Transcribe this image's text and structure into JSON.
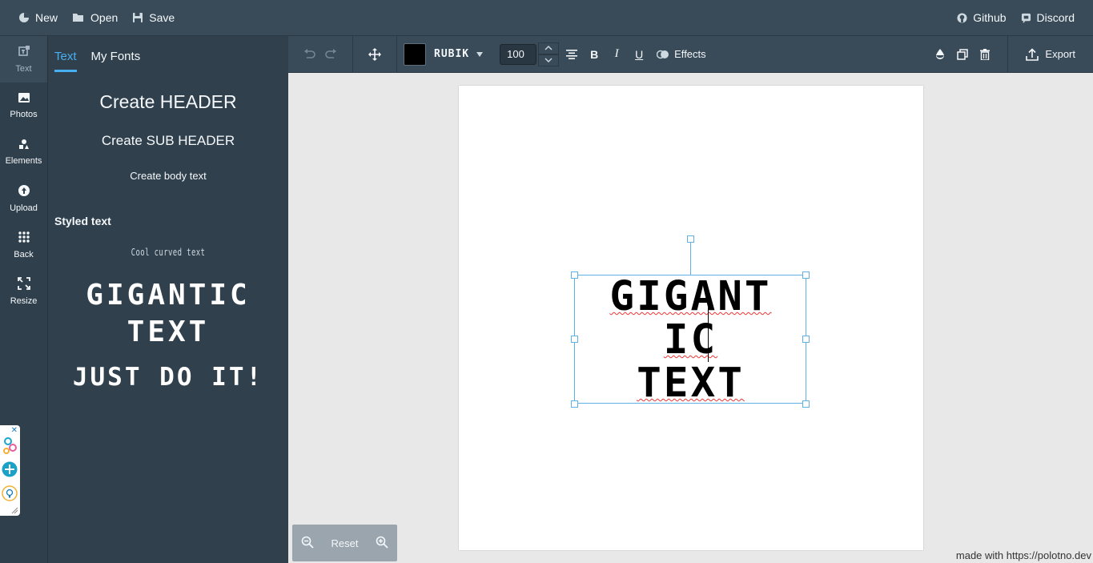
{
  "topbar": {
    "new_label": "New",
    "open_label": "Open",
    "save_label": "Save",
    "github_label": "Github",
    "discord_label": "Discord"
  },
  "iconbar": {
    "items": [
      {
        "label": "Text",
        "icon": "text-icon"
      },
      {
        "label": "Photos",
        "icon": "photos-icon"
      },
      {
        "label": "Elements",
        "icon": "elements-icon"
      },
      {
        "label": "Upload",
        "icon": "upload-icon"
      },
      {
        "label": "Back",
        "icon": "grid-icon"
      },
      {
        "label": "Resize",
        "icon": "resize-icon"
      }
    ],
    "active": "Text"
  },
  "panel": {
    "tabs": [
      "Text",
      "My Fonts"
    ],
    "active_tab": "Text",
    "create_header": "Create HEADER",
    "create_subheader": "Create SUB HEADER",
    "create_body": "Create body text",
    "styled_title": "Styled text",
    "styled_items": [
      "Cool curved text",
      "GIGANTIC TEXT",
      "JUST DO IT!"
    ]
  },
  "toolbar": {
    "color": "#000000",
    "font_name": "RUBIK",
    "font_size": "100",
    "effects_label": "Effects",
    "export_label": "Export"
  },
  "canvas": {
    "text_lines": [
      "GIGANT",
      "IC",
      "TEXT"
    ]
  },
  "zoom": {
    "reset_label": "Reset"
  },
  "credit": "made with https://polotno.dev",
  "colors": {
    "topbar_bg": "#394b59",
    "sidebar_bg": "#30404d",
    "accent": "#48aff0",
    "selection": "#5fb0e5"
  }
}
